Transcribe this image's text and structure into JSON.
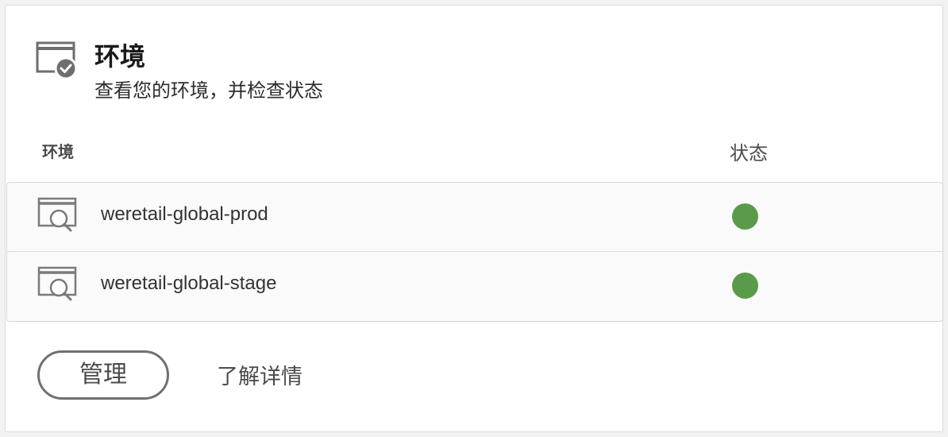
{
  "card": {
    "title": "环境",
    "subtitle": "查看您的环境，并检查状态",
    "header_icon": "environment-check-icon"
  },
  "table": {
    "columns": {
      "environment": "环境",
      "status": "状态"
    },
    "rows": [
      {
        "name": "weretail-global-prod",
        "icon": "environment-search-icon",
        "status_color": "#5c9a4b"
      },
      {
        "name": "weretail-global-stage",
        "icon": "environment-search-icon",
        "status_color": "#5c9a4b"
      }
    ]
  },
  "actions": {
    "manage_label": "管理",
    "learn_more_label": "了解详情"
  }
}
